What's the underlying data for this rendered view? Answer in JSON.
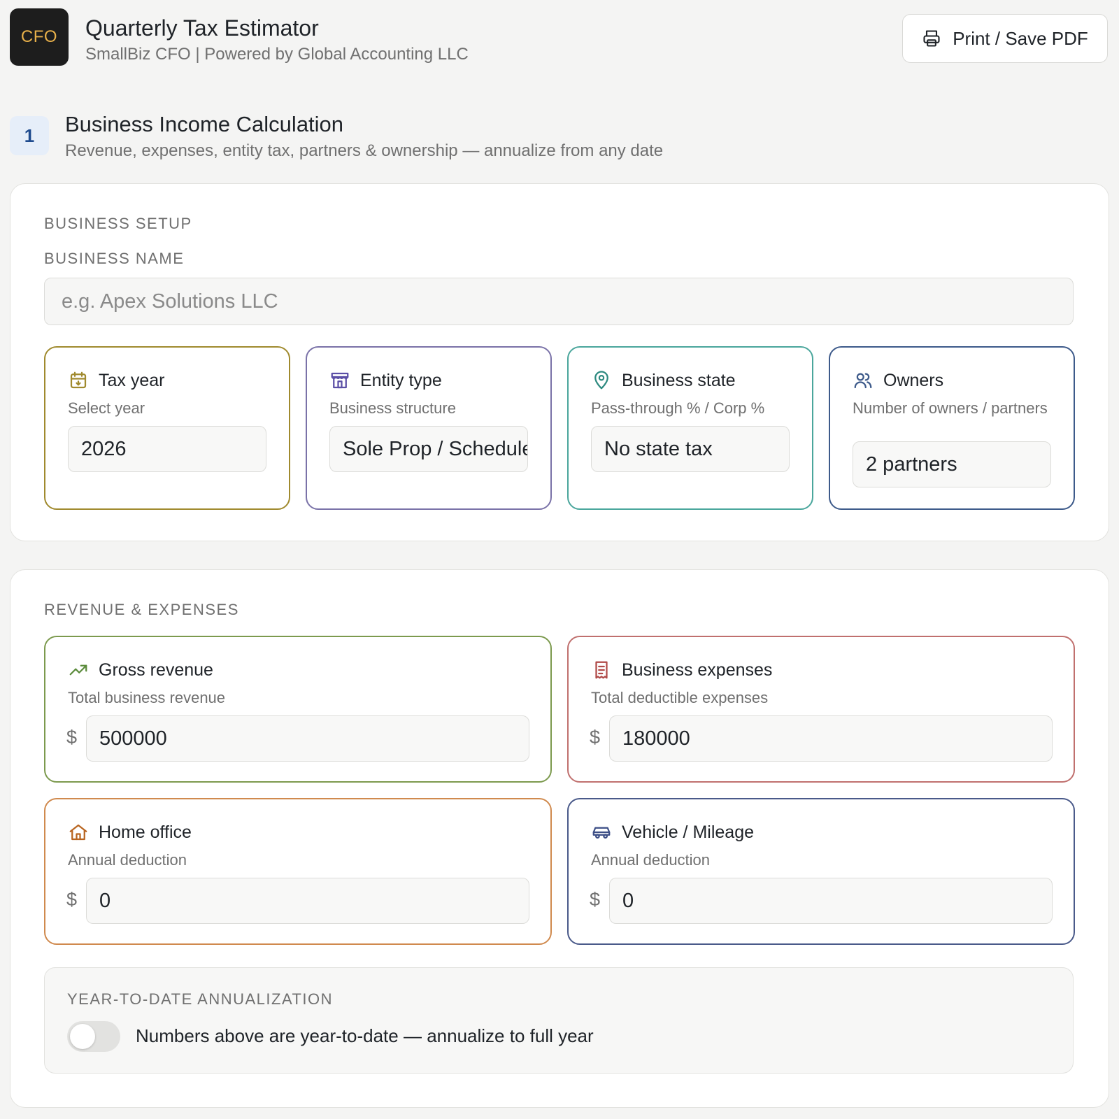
{
  "header": {
    "logo_text": "CFO",
    "title": "Quarterly Tax Estimator",
    "subtitle": "SmallBiz CFO | Powered by Global Accounting LLC",
    "print_label": "Print / Save PDF"
  },
  "section": {
    "step": "1",
    "title": "Business Income Calculation",
    "subtitle": "Revenue, expenses, entity tax, partners & ownership — annualize from any date"
  },
  "setup": {
    "group_label": "BUSINESS SETUP",
    "name_label": "BUSINESS NAME",
    "name_placeholder": "e.g. Apex Solutions LLC",
    "name_value": "",
    "cards": [
      {
        "icon": "calendar-icon",
        "title": "Tax year",
        "desc": "Select year",
        "value": "2026",
        "color": "#a08a2e"
      },
      {
        "icon": "store-icon",
        "title": "Entity type",
        "desc": "Business structure",
        "value": "Sole Prop / Schedule C",
        "color": "#7a72a8"
      },
      {
        "icon": "map-pin-icon",
        "title": "Business state",
        "desc": "Pass-through % / Corp %",
        "value": "No state tax",
        "color": "#4aa69c"
      },
      {
        "icon": "users-icon",
        "title": "Owners",
        "desc": "Number of owners / partners",
        "value": "2 partners",
        "color": "#3d5a8a"
      }
    ]
  },
  "revenue": {
    "group_label": "REVENUE & EXPENSES",
    "currency": "$",
    "cards": [
      {
        "icon": "trending-up-icon",
        "title": "Gross revenue",
        "desc": "Total business revenue",
        "value": "500000",
        "color": "#7c9a4e"
      },
      {
        "icon": "receipt-icon",
        "title": "Business expenses",
        "desc": "Total deductible expenses",
        "value": "180000",
        "color": "#c0706e"
      },
      {
        "icon": "home-icon",
        "title": "Home office",
        "desc": "Annual deduction",
        "value": "0",
        "color": "#d08a4e"
      },
      {
        "icon": "car-icon",
        "title": "Vehicle / Mileage",
        "desc": "Annual deduction",
        "value": "0",
        "color": "#4a5a8a"
      }
    ]
  },
  "annualization": {
    "label": "YEAR-TO-DATE ANNUALIZATION",
    "toggle_text": "Numbers above are year-to-date — annualize to full year",
    "enabled": false
  }
}
